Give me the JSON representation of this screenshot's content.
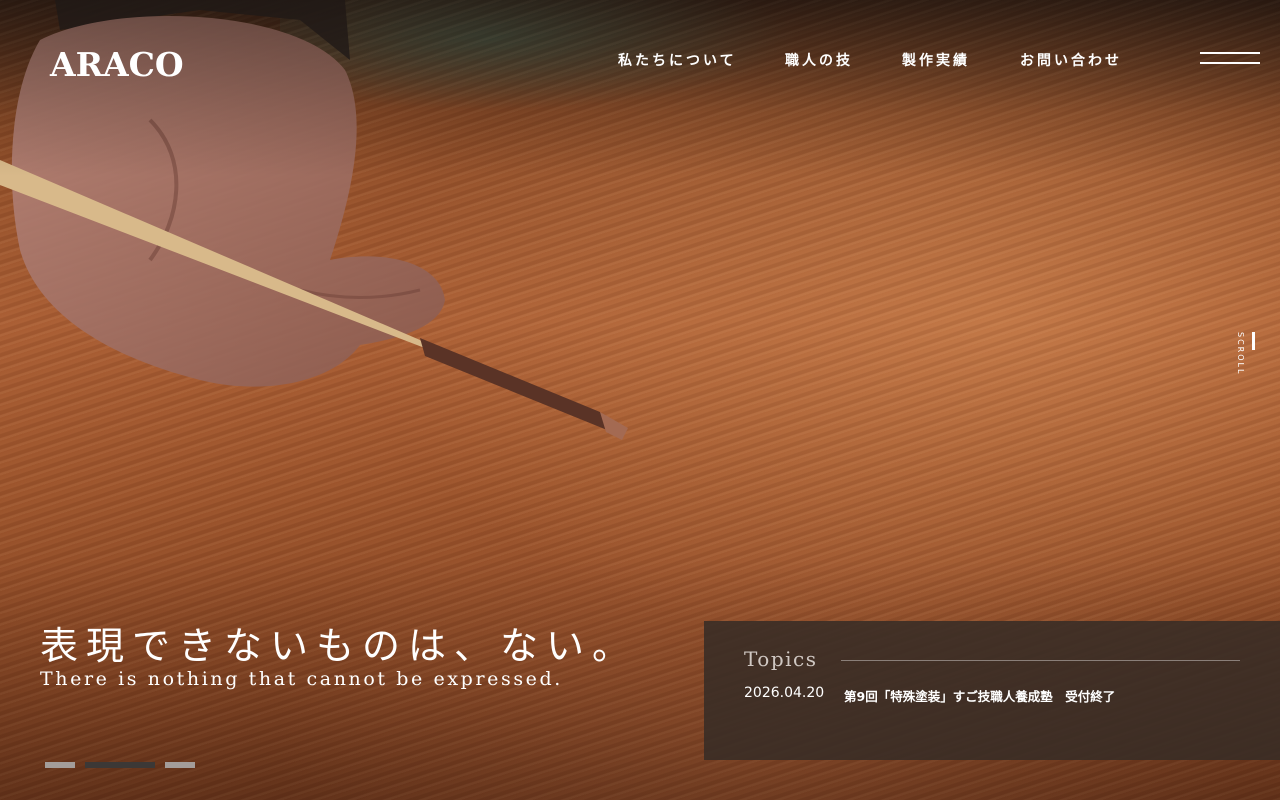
{
  "header": {
    "logo": "ARACO",
    "nav": [
      "私たちについて",
      "職人の技",
      "製作実績",
      "お問い合わせ"
    ]
  },
  "icons": {
    "menu": "hamburger-menu-icon",
    "scroll": "scroll-indicator"
  },
  "scroll_label": "SCROLL",
  "hero": {
    "headline": "表現できないものは、ない。",
    "subline": "There is nothing that cannot be expressed.",
    "slides": {
      "count": 3,
      "active_index": 1
    }
  },
  "topics": {
    "title": "Topics",
    "items": [
      {
        "date": "2026.04.20",
        "title": "第9回「特殊塗装」すご技職人養成塾　受付終了"
      }
    ]
  },
  "colors": {
    "dot_inactive": "#a39d9a",
    "dot_active": "#3c3836",
    "topics_bg": "#382c26"
  }
}
